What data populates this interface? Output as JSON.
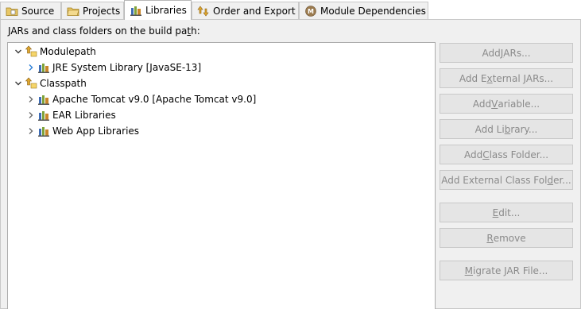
{
  "tabs": [
    {
      "label": "Source",
      "icon": "source-folder-icon"
    },
    {
      "label": "Projects",
      "icon": "projects-icon"
    },
    {
      "label": "Libraries",
      "icon": "libraries-icon",
      "active": true
    },
    {
      "label": "Order and Export",
      "icon": "order-export-icon"
    },
    {
      "label": "Module Dependencies",
      "icon": "module-icon"
    }
  ],
  "caption": {
    "pre": "JARs and class folders on the build pa",
    "mnemonic": "t",
    "post": "h:"
  },
  "tree": {
    "modulepath": {
      "label": "Modulepath",
      "expanded": true,
      "children": [
        {
          "label": "JRE System Library [JavaSE-13]"
        }
      ]
    },
    "classpath": {
      "label": "Classpath",
      "expanded": true,
      "children": [
        {
          "label": "Apache Tomcat v9.0 [Apache Tomcat v9.0]"
        },
        {
          "label": "EAR Libraries"
        },
        {
          "label": "Web App Libraries"
        }
      ]
    }
  },
  "buttons": [
    {
      "pre": "Add ",
      "mn": "J",
      "post": "ARs..."
    },
    {
      "pre": "Add E",
      "mn": "x",
      "post": "ternal JARs..."
    },
    {
      "pre": "Add ",
      "mn": "V",
      "post": "ariable..."
    },
    {
      "pre": "Add Li",
      "mn": "b",
      "post": "rary..."
    },
    {
      "pre": "Add ",
      "mn": "C",
      "post": "lass Folder..."
    },
    {
      "pre": "Add External Class Fol",
      "mn": "d",
      "post": "er..."
    },
    {
      "pre": "",
      "mn": "E",
      "post": "dit..."
    },
    {
      "pre": "",
      "mn": "R",
      "post": "emove"
    },
    {
      "pre": "",
      "mn": "M",
      "post": "igrate JAR File..."
    }
  ],
  "colors": {
    "panel_bg": "#f0f0f0",
    "button_disabled_text": "#8a8a8a",
    "twistie": "#2c7fd6"
  }
}
